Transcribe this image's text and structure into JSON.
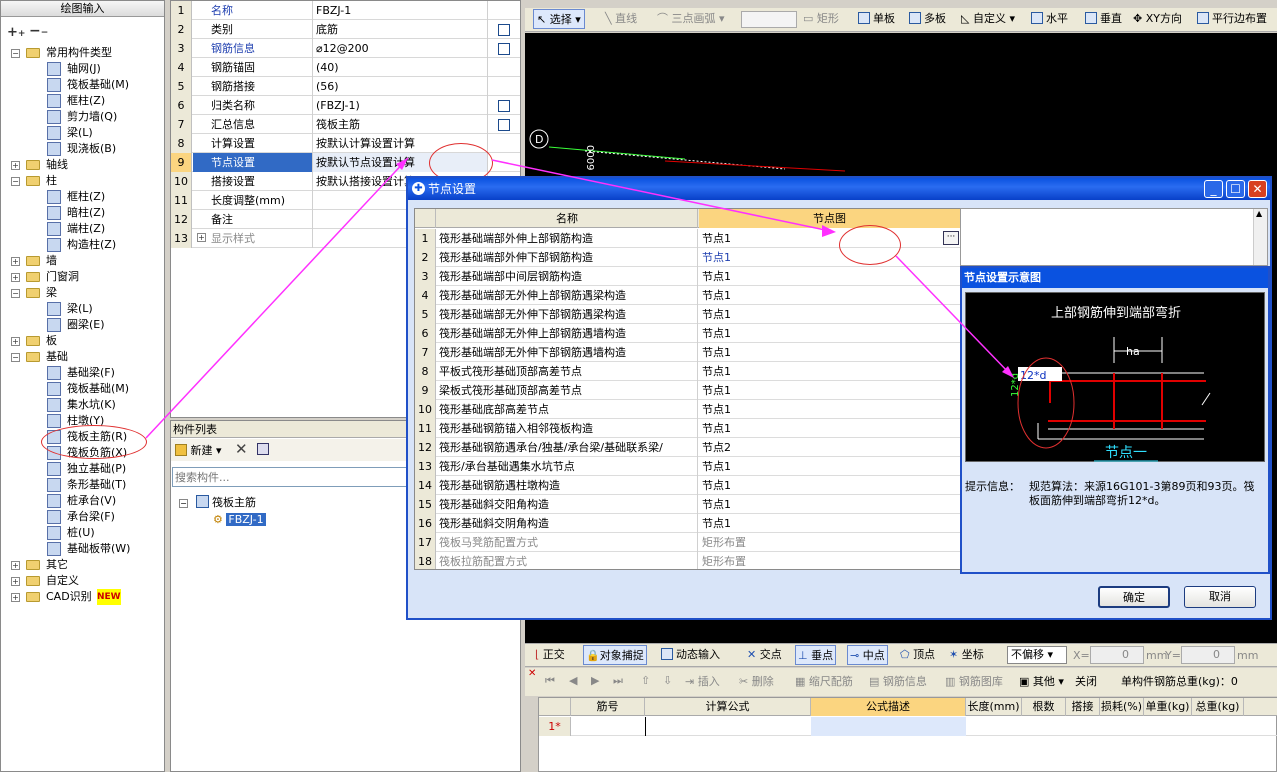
{
  "left_panel": {
    "title": "绘图输入",
    "tree": [
      {
        "label": "常用构件类型",
        "level": 0,
        "kind": "folder",
        "expanded": true
      },
      {
        "label": "轴网(J)",
        "level": 1,
        "kind": "item"
      },
      {
        "label": "筏板基础(M)",
        "level": 1,
        "kind": "item"
      },
      {
        "label": "框柱(Z)",
        "level": 1,
        "kind": "item"
      },
      {
        "label": "剪力墙(Q)",
        "level": 1,
        "kind": "item"
      },
      {
        "label": "梁(L)",
        "level": 1,
        "kind": "item"
      },
      {
        "label": "现浇板(B)",
        "level": 1,
        "kind": "item"
      },
      {
        "label": "轴线",
        "level": 0,
        "kind": "folder",
        "expanded": false
      },
      {
        "label": "柱",
        "level": 0,
        "kind": "folder",
        "expanded": true
      },
      {
        "label": "框柱(Z)",
        "level": 1,
        "kind": "item"
      },
      {
        "label": "暗柱(Z)",
        "level": 1,
        "kind": "item"
      },
      {
        "label": "端柱(Z)",
        "level": 1,
        "kind": "item"
      },
      {
        "label": "构造柱(Z)",
        "level": 1,
        "kind": "item"
      },
      {
        "label": "墙",
        "level": 0,
        "kind": "folder",
        "expanded": false
      },
      {
        "label": "门窗洞",
        "level": 0,
        "kind": "folder",
        "expanded": false
      },
      {
        "label": "梁",
        "level": 0,
        "kind": "folder",
        "expanded": true
      },
      {
        "label": "梁(L)",
        "level": 1,
        "kind": "item"
      },
      {
        "label": "圈梁(E)",
        "level": 1,
        "kind": "item"
      },
      {
        "label": "板",
        "level": 0,
        "kind": "folder",
        "expanded": false
      },
      {
        "label": "基础",
        "level": 0,
        "kind": "folder",
        "expanded": true
      },
      {
        "label": "基础梁(F)",
        "level": 1,
        "kind": "item"
      },
      {
        "label": "筏板基础(M)",
        "level": 1,
        "kind": "item"
      },
      {
        "label": "集水坑(K)",
        "level": 1,
        "kind": "item"
      },
      {
        "label": "柱墩(Y)",
        "level": 1,
        "kind": "item"
      },
      {
        "label": "筏板主筋(R)",
        "level": 1,
        "kind": "item"
      },
      {
        "label": "筏板负筋(X)",
        "level": 1,
        "kind": "item"
      },
      {
        "label": "独立基础(P)",
        "level": 1,
        "kind": "item"
      },
      {
        "label": "条形基础(T)",
        "level": 1,
        "kind": "item"
      },
      {
        "label": "桩承台(V)",
        "level": 1,
        "kind": "item"
      },
      {
        "label": "承台梁(F)",
        "level": 1,
        "kind": "item"
      },
      {
        "label": "桩(U)",
        "level": 1,
        "kind": "item"
      },
      {
        "label": "基础板带(W)",
        "level": 1,
        "kind": "item"
      },
      {
        "label": "其它",
        "level": 0,
        "kind": "folder",
        "expanded": false
      },
      {
        "label": "自定义",
        "level": 0,
        "kind": "folder",
        "expanded": false
      },
      {
        "label": "CAD识别",
        "level": 0,
        "kind": "folder",
        "expanded": false,
        "badge": "NEW"
      }
    ]
  },
  "props": {
    "rows": [
      {
        "n": "1",
        "name": "名称",
        "value": "FBZJ-1",
        "blue": true,
        "check": false
      },
      {
        "n": "2",
        "name": "类别",
        "value": "底筋",
        "blue": false,
        "check": true
      },
      {
        "n": "3",
        "name": "钢筋信息",
        "value": "⌀12@200",
        "blue": true,
        "check": true
      },
      {
        "n": "4",
        "name": "钢筋锚固",
        "value": "(40)",
        "blue": false,
        "check": false
      },
      {
        "n": "5",
        "name": "钢筋搭接",
        "value": "(56)",
        "blue": false,
        "check": false
      },
      {
        "n": "6",
        "name": "归类名称",
        "value": "(FBZJ-1)",
        "blue": false,
        "check": true
      },
      {
        "n": "7",
        "name": "汇总信息",
        "value": "筏板主筋",
        "blue": false,
        "check": true
      },
      {
        "n": "8",
        "name": "计算设置",
        "value": "按默认计算设置计算",
        "blue": false,
        "check": false
      },
      {
        "n": "9",
        "name": "节点设置",
        "value": "按默认节点设置计算",
        "blue": false,
        "check": false,
        "selected": true
      },
      {
        "n": "10",
        "name": "搭接设置",
        "value": "按默认搭接设置计算",
        "blue": false,
        "check": false
      },
      {
        "n": "11",
        "name": "长度调整(mm)",
        "value": "",
        "blue": false,
        "check": false
      },
      {
        "n": "12",
        "name": "备注",
        "value": "",
        "blue": false,
        "check": false
      },
      {
        "n": "13",
        "name": "显示样式",
        "value": "",
        "blue": false,
        "check": false,
        "gray": true,
        "expander": "+"
      }
    ]
  },
  "component_list": {
    "title": "构件列表",
    "new_label": "新建",
    "search_placeholder": "搜索构件...",
    "tree_root": "筏板主筋",
    "tree_child": "FBZJ-1"
  },
  "top_toolbar": {
    "select": "选择",
    "line": "直线",
    "arc": "三点画弧",
    "rect": "矩形",
    "single": "单板",
    "multi": "多板",
    "custom": "自定义",
    "horizontal": "水平",
    "vertical": "垂直",
    "xy": "XY方向",
    "parallel": "平行边布置"
  },
  "canvas": {
    "axis_label": "D",
    "dim_text": "0009"
  },
  "dialog": {
    "title": "节点设置",
    "col_name": "名称",
    "col_node": "节点图",
    "rows": [
      {
        "n": "1",
        "name": "筏形基础端部外伸上部钢筋构造",
        "value": "节点1",
        "blue": false,
        "ellipsis": true
      },
      {
        "n": "2",
        "name": "筏形基础端部外伸下部钢筋构造",
        "value": "节点1",
        "blue": true
      },
      {
        "n": "3",
        "name": "筏形基础端部中间层钢筋构造",
        "value": "节点1"
      },
      {
        "n": "4",
        "name": "筏形基础端部无外伸上部钢筋遇梁构造",
        "value": "节点1"
      },
      {
        "n": "5",
        "name": "筏形基础端部无外伸下部钢筋遇梁构造",
        "value": "节点1"
      },
      {
        "n": "6",
        "name": "筏形基础端部无外伸上部钢筋遇墙构造",
        "value": "节点1"
      },
      {
        "n": "7",
        "name": "筏形基础端部无外伸下部钢筋遇墙构造",
        "value": "节点1"
      },
      {
        "n": "8",
        "name": "平板式筏形基础顶部高差节点",
        "value": "节点1"
      },
      {
        "n": "9",
        "name": "梁板式筏形基础顶部高差节点",
        "value": "节点1"
      },
      {
        "n": "10",
        "name": "筏形基础底部高差节点",
        "value": "节点1"
      },
      {
        "n": "11",
        "name": "筏形基础钢筋锚入相邻筏板构造",
        "value": "节点1"
      },
      {
        "n": "12",
        "name": "筏形基础钢筋遇承台/独基/承台梁/基础联系梁/",
        "value": "节点2"
      },
      {
        "n": "13",
        "name": "筏形/承台基础遇集水坑节点",
        "value": "节点1"
      },
      {
        "n": "14",
        "name": "筏形基础钢筋遇柱墩构造",
        "value": "节点1"
      },
      {
        "n": "15",
        "name": "筏形基础斜交阳角构造",
        "value": "节点1"
      },
      {
        "n": "16",
        "name": "筏形基础斜交阴角构造",
        "value": "节点1"
      },
      {
        "n": "17",
        "name": "筏板马凳筋配置方式",
        "value": "矩形布置",
        "gray": true
      },
      {
        "n": "18",
        "name": "筏板拉筋配置方式",
        "value": "矩形布置",
        "gray": true
      }
    ],
    "preview_title": "节点设置示意图",
    "diagram_heading": "上部钢筋伸到端部弯折",
    "diagram_label": "12*d",
    "diagram_vert": "12*d",
    "diagram_ha": "ha",
    "diagram_node": "节点一",
    "hint_label": "提示信息：",
    "hint_text": "规范算法：来源16G101-3第89页和93页。筏板面筋伸到端部弯折12*d。",
    "ok": "确定",
    "cancel": "取消"
  },
  "bottom_toolbar": {
    "ortho": "正交",
    "snap": "对象捕捉",
    "dyn": "动态输入",
    "intersect": "交点",
    "perp": "垂点",
    "mid": "中点",
    "vertex": "顶点",
    "coord": "坐标",
    "offset": "不偏移",
    "x_label": "X=",
    "x_val": "0",
    "y_label": "Y=",
    "y_val": "0",
    "mm": "mm"
  },
  "rebar_toolbar": {
    "insert": "插入",
    "delete": "删除",
    "scale": "缩尺配筋",
    "info": "钢筋信息",
    "lib": "钢筋图库",
    "other": "其他",
    "close": "关闭",
    "total": "单构件钢筋总重(kg)：0"
  },
  "rebar_grid": {
    "cols": [
      "筋号",
      "计算公式",
      "公式描述",
      "长度(mm)",
      "根数",
      "搭接",
      "损耗(%)",
      "单重(kg)",
      "总重(kg)"
    ],
    "row1": "1*"
  },
  "colors": {
    "accent": "#0a52e0",
    "selected": "#316ac5",
    "annotation": "#ff30ff",
    "red": "#e00000"
  }
}
